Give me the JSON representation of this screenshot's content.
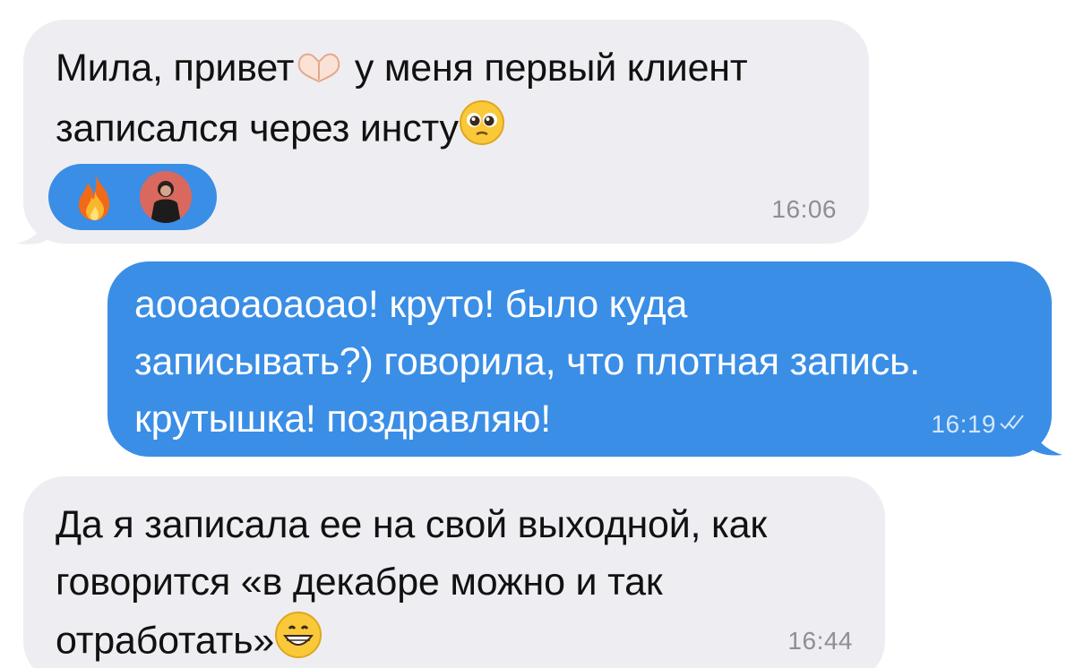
{
  "conversation": {
    "messages": [
      {
        "direction": "incoming",
        "text_part1": "Мила, привет",
        "text_part2": " у меня первый клиент\nзаписался через инсту",
        "emojis": [
          "heart-hands-icon",
          "pleading-face-icon"
        ],
        "time": "16:06",
        "reaction": {
          "emoji": "fire-icon",
          "reactor": "avatar"
        }
      },
      {
        "direction": "outgoing",
        "text": "аооаоаоаоао! круто! было куда\nзаписывать?) говорила, что плотная запись.\nкрутышка! поздравляю!",
        "time": "16:19",
        "status": "read-double-check-icon"
      },
      {
        "direction": "incoming",
        "text": "Да я записала ее на свой выходной, как\nговорится «в декабре можно и так\nотработать»",
        "emojis": [
          "grinning-face-icon"
        ],
        "time": "16:44"
      }
    ]
  },
  "colors": {
    "incoming_bubble": "#eeeef2",
    "outgoing_bubble": "#3a8ee6",
    "incoming_text": "#111111",
    "outgoing_text": "#ffffff",
    "timestamp_incoming": "#8e8e93"
  }
}
